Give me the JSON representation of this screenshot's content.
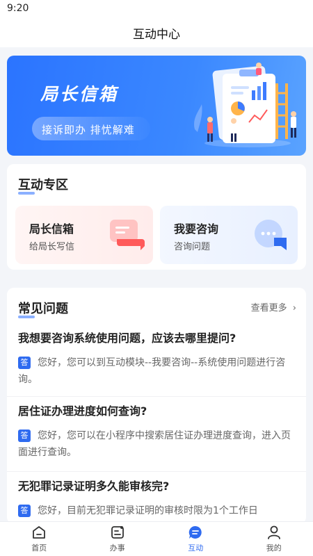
{
  "status_bar": {
    "time": "9:20"
  },
  "header": {
    "title": "互动中心"
  },
  "banner": {
    "title": "局长信箱",
    "subtitle": "接诉即办  排忧解难"
  },
  "zone": {
    "title": "互动专区",
    "tiles": [
      {
        "title": "局长信箱",
        "subtitle": "给局长写信",
        "icon": "mail-chat-icon"
      },
      {
        "title": "我要咨询",
        "subtitle": "咨询问题",
        "icon": "chat-bubble-icon"
      }
    ]
  },
  "faq": {
    "title": "常见问题",
    "more": "查看更多",
    "answer_badge": "答",
    "items": [
      {
        "question": "我想要咨询系统使用问题，应该去哪里提问?",
        "answer": "您好，您可以到互动模块--我要咨询--系统使用问题进行咨询。"
      },
      {
        "question": "居住证办理进度如何查询?",
        "answer": "您好，您可以在小程序中搜索居住证办理进度查询，进入页面进行查询。"
      },
      {
        "question": "无犯罪记录证明多久能审核完?",
        "answer": "您好，目前无犯罪记录证明的审核时限为1个工作日"
      }
    ]
  },
  "tabs": [
    {
      "label": "首页",
      "icon": "home-icon",
      "active": false
    },
    {
      "label": "办事",
      "icon": "task-icon",
      "active": false
    },
    {
      "label": "互动",
      "icon": "chat-icon",
      "active": true
    },
    {
      "label": "我的",
      "icon": "user-icon",
      "active": false
    }
  ],
  "colors": {
    "accent": "#2f6bf0",
    "banner": "#3b88ff"
  }
}
